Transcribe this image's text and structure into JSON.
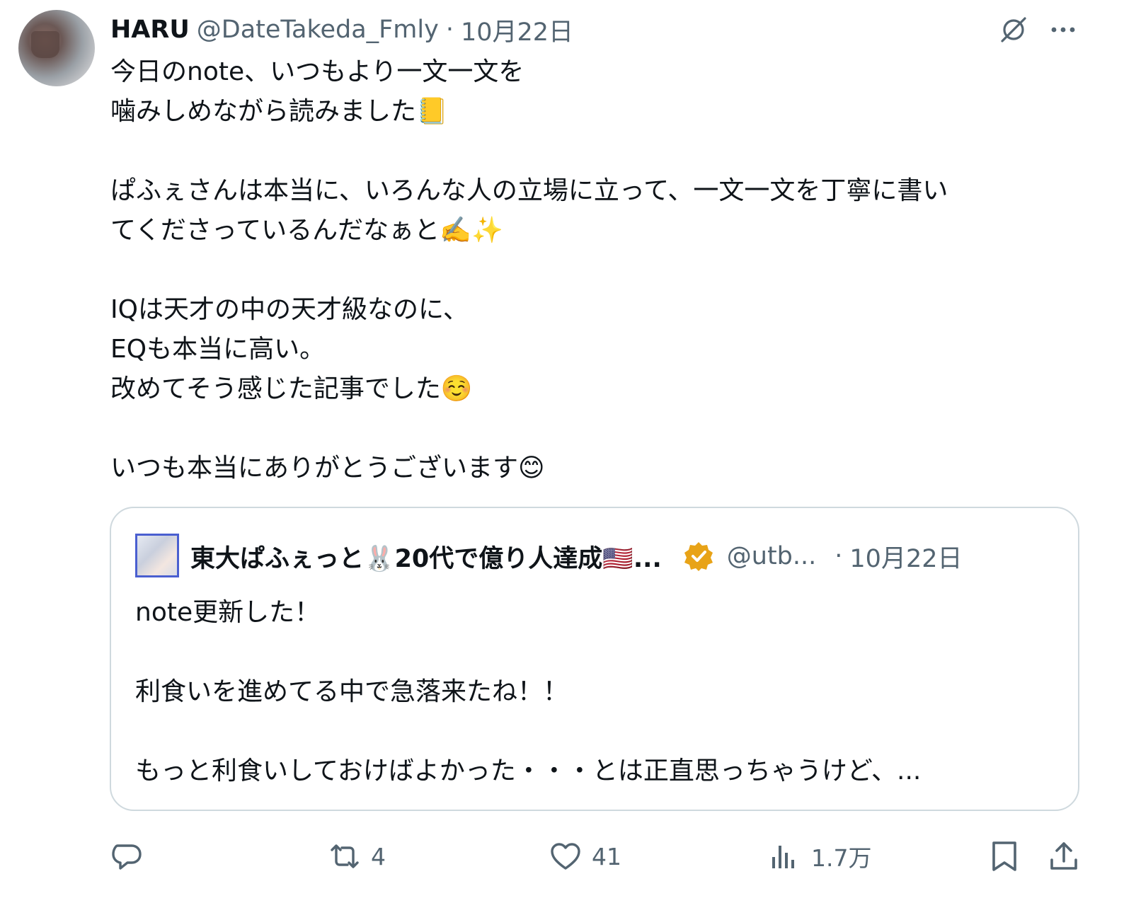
{
  "post": {
    "author_name": "HARU",
    "author_handle": "@DateTakeda_Fmly",
    "separator": "·",
    "date": "10月22日",
    "avatar_icon": "user-avatar",
    "grok_icon": "grok-icon",
    "more_icon": "more-icon",
    "text": "今日のnote、いつもより一文一文を\n噛みしめながら読みました📒\n\nぱふぇさんは本当に、いろんな人の立場に立って、一文一文を丁寧に書い\nてくださっているんだなぁと✍️✨\n\nIQは天才の中の天才級なのに、\nEQも本当に高い。\n改めてそう感じた記事でした☺️\n\nいつも本当にありがとうございます😊"
  },
  "quoted_post": {
    "author_name": "東大ぱふぇっと🐰20代で億り人達成🇺🇸...",
    "verified_icon": "verified-badge-icon",
    "author_handle": "@utb...",
    "separator": "·",
    "date": "10月22日",
    "text": "note更新した！\n\n利食いを進めてる中で急落来たね！！\n\nもっと利食いしておけばよかった・・・とは正直思っちゃうけど、..."
  },
  "actions": {
    "reply": {
      "icon": "reply-icon",
      "count": ""
    },
    "retweet": {
      "icon": "retweet-icon",
      "count": "4"
    },
    "like": {
      "icon": "heart-icon",
      "count": "41"
    },
    "views": {
      "icon": "views-icon",
      "count": "1.7万"
    },
    "bookmark": {
      "icon": "bookmark-icon"
    },
    "share": {
      "icon": "share-icon"
    }
  },
  "colors": {
    "text": "#0f1419",
    "secondary": "#536471",
    "border": "#cfd9de",
    "verified_gold": "#e8a317"
  }
}
